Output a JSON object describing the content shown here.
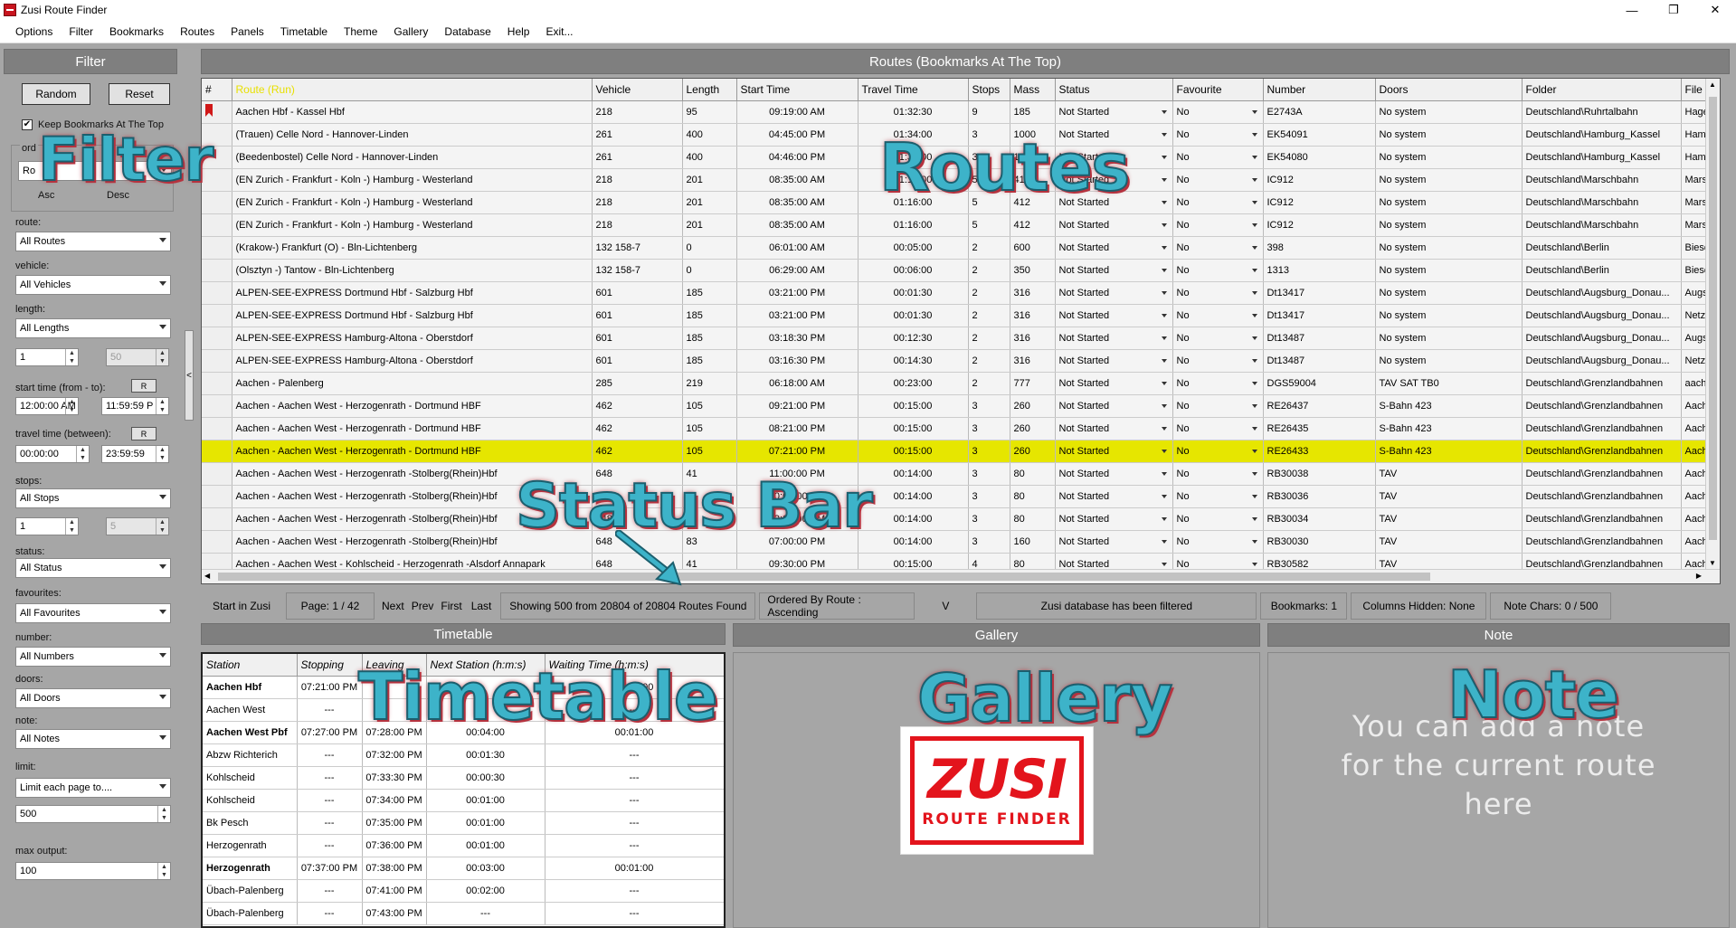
{
  "window": {
    "title": "Zusi Route Finder",
    "minimize": "—",
    "maximize": "❐",
    "close": "✕"
  },
  "menu": [
    "Options",
    "Filter",
    "Bookmarks",
    "Routes",
    "Panels",
    "Timetable",
    "Theme",
    "Gallery",
    "Database",
    "Help",
    "Exit..."
  ],
  "filter": {
    "header": "Filter",
    "random": "Random",
    "reset": "Reset",
    "keep_bookmarks": "Keep Bookmarks At The Top",
    "keep_bookmarks_checked": "✔",
    "order_label": "ord",
    "order_value": "Ro",
    "asc": "Asc",
    "desc": "Desc",
    "route_label": "route:",
    "route_value": "All Routes",
    "vehicle_label": "vehicle:",
    "vehicle_value": "All Vehicles",
    "length_label": "length:",
    "length_value": "All Lengths",
    "length_min": "1",
    "length_max": "50",
    "start_label": "start time (from - to):",
    "start_r": "R",
    "start_from": "12:00:00 AM",
    "start_to": "11:59:59 P",
    "travel_label": "travel time (between):",
    "travel_r": "R",
    "travel_from": "00:00:00",
    "travel_to": "23:59:59",
    "stops_label": "stops:",
    "stops_value": "All Stops",
    "stops_min": "1",
    "stops_max": "5",
    "status_label": "status:",
    "status_value": "All Status",
    "fav_label": "favourites:",
    "fav_value": "All Favourites",
    "number_label": "number:",
    "number_value": "All Numbers",
    "doors_label": "doors:",
    "doors_value": "All Doors",
    "note_label": "note:",
    "note_value": "All Notes",
    "limit_label": "limit:",
    "limit_value": "Limit each page to....",
    "limit_num": "500",
    "max_label": "max output:",
    "max_num": "100",
    "splitter": "<"
  },
  "routes": {
    "header": "Routes (Bookmarks At The Top)",
    "columns": [
      "#",
      "Route (Run)",
      "Vehicle",
      "Length",
      "Start Time",
      "Travel Time",
      "Stops",
      "Mass",
      "Status",
      "Favourite",
      "Number",
      "Doors",
      "Folder",
      "File"
    ],
    "rows": [
      [
        "",
        "Aachen Hbf - Kassel Hbf",
        "218",
        "95",
        "09:19:00 AM",
        "01:32:30",
        "9",
        "185",
        "Not Started",
        "No",
        "E2743A",
        "No system",
        "Deutschland\\Ruhrtalbahn",
        "Hagen-"
      ],
      [
        "",
        " (Trauen) Celle Nord - Hannover-Linden",
        "261",
        "400",
        "04:45:00 PM",
        "01:34:00",
        "3",
        "1000",
        "Not Started",
        "No",
        "EK54091",
        "No system",
        "Deutschland\\Hamburg_Kassel",
        "Hameln"
      ],
      [
        "",
        "(Beedenbostel) Celle Nord - Hannover-Linden",
        "261",
        "400",
        "04:46:00 PM",
        "01:31:00",
        "3",
        "1000",
        "Not Started",
        "No",
        "EK54080",
        "No system",
        "Deutschland\\Hamburg_Kassel",
        "Hameln"
      ],
      [
        "",
        "(EN Zurich - Frankfurt - Koln -) Hamburg - Westerland",
        "218",
        "201",
        "08:35:00 AM",
        "01:16:00",
        "5",
        "412",
        "Not Started",
        "No",
        "IC912",
        "No system",
        "Deutschland\\Marschbahn",
        "Marsch"
      ],
      [
        "",
        "(EN Zurich - Frankfurt - Koln -) Hamburg - Westerland",
        "218",
        "201",
        "08:35:00 AM",
        "01:16:00",
        "5",
        "412",
        "Not Started",
        "No",
        "IC912",
        "No system",
        "Deutschland\\Marschbahn",
        "Marsch"
      ],
      [
        "",
        "(EN Zurich - Frankfurt - Koln -) Hamburg - Westerland",
        "218",
        "201",
        "08:35:00 AM",
        "01:16:00",
        "5",
        "412",
        "Not Started",
        "No",
        "IC912",
        "No system",
        "Deutschland\\Marschbahn",
        "Marsch"
      ],
      [
        "",
        "(Krakow-) Frankfurt (O) - Bln-Lichtenberg",
        "132 158-7",
        "0",
        "06:01:00 AM",
        "00:05:00",
        "2",
        "600",
        "Not Started",
        "No",
        "398",
        "No system",
        "Deutschland\\Berlin",
        "Biesdor"
      ],
      [
        "",
        "(Olsztyn -) Tantow - Bln-Lichtenberg",
        "132 158-7",
        "0",
        "06:29:00 AM",
        "00:06:00",
        "2",
        "350",
        "Not Started",
        "No",
        "1313",
        "No system",
        "Deutschland\\Berlin",
        "Biesdor"
      ],
      [
        "",
        "ALPEN-SEE-EXPRESS Dortmund Hbf - Salzburg Hbf",
        "601",
        "185",
        "03:21:00 PM",
        "00:01:30",
        "2",
        "316",
        "Not Started",
        "No",
        "Dt13417",
        "No system",
        "Deutschland\\Augsburg_Donau...",
        "Augsbu"
      ],
      [
        "",
        "ALPEN-SEE-EXPRESS Dortmund Hbf - Salzburg Hbf",
        "601",
        "185",
        "03:21:00 PM",
        "00:01:30",
        "2",
        "316",
        "Not Started",
        "No",
        "Dt13417",
        "No system",
        "Deutschland\\Augsburg_Donau...",
        "Netz_A"
      ],
      [
        "",
        "ALPEN-SEE-EXPRESS Hamburg-Altona - Oberstdorf",
        "601",
        "185",
        "03:18:30 PM",
        "00:12:30",
        "2",
        "316",
        "Not Started",
        "No",
        "Dt13487",
        "No system",
        "Deutschland\\Augsburg_Donau...",
        "Augsbu"
      ],
      [
        "",
        "ALPEN-SEE-EXPRESS Hamburg-Altona - Oberstdorf",
        "601",
        "185",
        "03:16:30 PM",
        "00:14:30",
        "2",
        "316",
        "Not Started",
        "No",
        "Dt13487",
        "No system",
        "Deutschland\\Augsburg_Donau...",
        "Netz_A"
      ],
      [
        "",
        "Aachen -  Palenberg",
        "285",
        "219",
        "06:18:00 AM",
        "00:23:00",
        "2",
        "777",
        "Not Started",
        "No",
        "DGS59004",
        "TAV SAT TB0",
        "Deutschland\\Grenzlandbahnen",
        "aachen"
      ],
      [
        "",
        "Aachen - Aachen West - Herzogenrath - Dortmund HBF",
        "462",
        "105",
        "09:21:00 PM",
        "00:15:00",
        "3",
        "260",
        "Not Started",
        "No",
        "RE26437",
        "S-Bahn 423",
        "Deutschland\\Grenzlandbahnen",
        "Aachen"
      ],
      [
        "",
        "Aachen - Aachen West - Herzogenrath - Dortmund HBF",
        "462",
        "105",
        "08:21:00 PM",
        "00:15:00",
        "3",
        "260",
        "Not Started",
        "No",
        "RE26435",
        "S-Bahn 423",
        "Deutschland\\Grenzlandbahnen",
        "Aachen"
      ],
      [
        "",
        "Aachen - Aachen West - Herzogenrath - Dortmund HBF",
        "462",
        "105",
        "07:21:00 PM",
        "00:15:00",
        "3",
        "260",
        "Not Started",
        "No",
        "RE26433",
        "S-Bahn 423",
        "Deutschland\\Grenzlandbahnen",
        "Aachen"
      ],
      [
        "",
        "Aachen - Aachen West - Herzogenrath -Stolberg(Rhein)Hbf",
        "648",
        "41",
        "11:00:00 PM",
        "00:14:00",
        "3",
        "80",
        "Not Started",
        "No",
        "RB30038",
        "TAV",
        "Deutschland\\Grenzlandbahnen",
        "Aachen"
      ],
      [
        "",
        "Aachen - Aachen West - Herzogenrath -Stolberg(Rhein)Hbf",
        "648",
        "41",
        "10:00:00 PM",
        "00:14:00",
        "3",
        "80",
        "Not Started",
        "No",
        "RB30036",
        "TAV",
        "Deutschland\\Grenzlandbahnen",
        "Aachen"
      ],
      [
        "",
        "Aachen - Aachen West - Herzogenrath -Stolberg(Rhein)Hbf",
        "648",
        "41",
        "09:00:00 PM",
        "00:14:00",
        "3",
        "80",
        "Not Started",
        "No",
        "RB30034",
        "TAV",
        "Deutschland\\Grenzlandbahnen",
        "Aachen"
      ],
      [
        "",
        "Aachen - Aachen West - Herzogenrath -Stolberg(Rhein)Hbf",
        "648",
        "83",
        "07:00:00 PM",
        "00:14:00",
        "3",
        "160",
        "Not Started",
        "No",
        "RB30030",
        "TAV",
        "Deutschland\\Grenzlandbahnen",
        "Aachen"
      ],
      [
        "",
        "Aachen - Aachen West - Kohlscheid - Herzogenrath -Alsdorf Annapark",
        "648",
        "41",
        "09:30:00 PM",
        "00:15:00",
        "4",
        "80",
        "Not Started",
        "No",
        "RB30582",
        "TAV",
        "Deutschland\\Grenzlandbahnen",
        "Aachen"
      ]
    ],
    "bookmarked_row": 0,
    "selected_row": 15,
    "scroll_up": "▲",
    "scroll_down": "▼",
    "scroll_left": "◀",
    "scroll_right": "▶"
  },
  "statusbar": {
    "start": "Start in Zusi",
    "page": "Page: 1 / 42",
    "next": "Next",
    "prev": "Prev",
    "first": "First",
    "last": "Last",
    "showing": "Showing 500 from 20804 of 20804 Routes Found",
    "ordered": "Ordered By Route : Ascending",
    "v": "V",
    "filtered": "Zusi database has been filtered",
    "bookmarks": "Bookmarks: 1",
    "columns_hidden": "Columns Hidden: None",
    "note_chars": "Note Chars: 0 / 500"
  },
  "timetable": {
    "header": "Timetable",
    "columns": [
      "Station",
      "Stopping",
      "Leaving",
      "Next Station (h:m:s)",
      "Waiting Time (h:m:s)"
    ],
    "rows": [
      [
        "Aachen Hbf",
        "07:21:00 PM",
        "",
        "",
        "00:01:00"
      ],
      [
        "Aachen West",
        "---",
        "",
        "",
        "---"
      ],
      [
        "Aachen West Pbf",
        "07:27:00 PM",
        "07:28:00 PM",
        "00:04:00",
        "00:01:00"
      ],
      [
        "Abzw Richterich",
        "---",
        "07:32:00 PM",
        "00:01:30",
        "---"
      ],
      [
        "Kohlscheid",
        "---",
        "07:33:30 PM",
        "00:00:30",
        "---"
      ],
      [
        "Kohlscheid",
        "---",
        "07:34:00 PM",
        "00:01:00",
        "---"
      ],
      [
        "Bk Pesch",
        "---",
        "07:35:00 PM",
        "00:01:00",
        "---"
      ],
      [
        "Herzogenrath",
        "---",
        "07:36:00 PM",
        "00:01:00",
        "---"
      ],
      [
        "Herzogenrath",
        "07:37:00 PM",
        "07:38:00 PM",
        "00:03:00",
        "00:01:00"
      ],
      [
        "Übach-Palenberg",
        "---",
        "07:41:00 PM",
        "00:02:00",
        "---"
      ],
      [
        "Übach-Palenberg",
        "---",
        "07:43:00 PM",
        "---",
        "---"
      ]
    ],
    "bold_rows": [
      0,
      2,
      8
    ]
  },
  "gallery": {
    "header": "Gallery",
    "logo_main": "ZUSI",
    "logo_sub": "ROUTE FINDER"
  },
  "note": {
    "header": "Note",
    "placeholder_lines": [
      "You can add a note",
      "for the current route",
      "here"
    ]
  },
  "annotations": {
    "filter": "Filter",
    "routes": "Routes",
    "status_bar": "Status Bar",
    "timetable": "Timetable",
    "gallery": "Gallery",
    "note": "Note"
  },
  "colors": {
    "selected_row": "#e6e600",
    "panel_header": "#7f7f7f",
    "background": "#a6a6a6",
    "annotation_fill": "#3db3c9",
    "annotation_shadow": "#b5323e",
    "logo_red": "#e3141c"
  }
}
